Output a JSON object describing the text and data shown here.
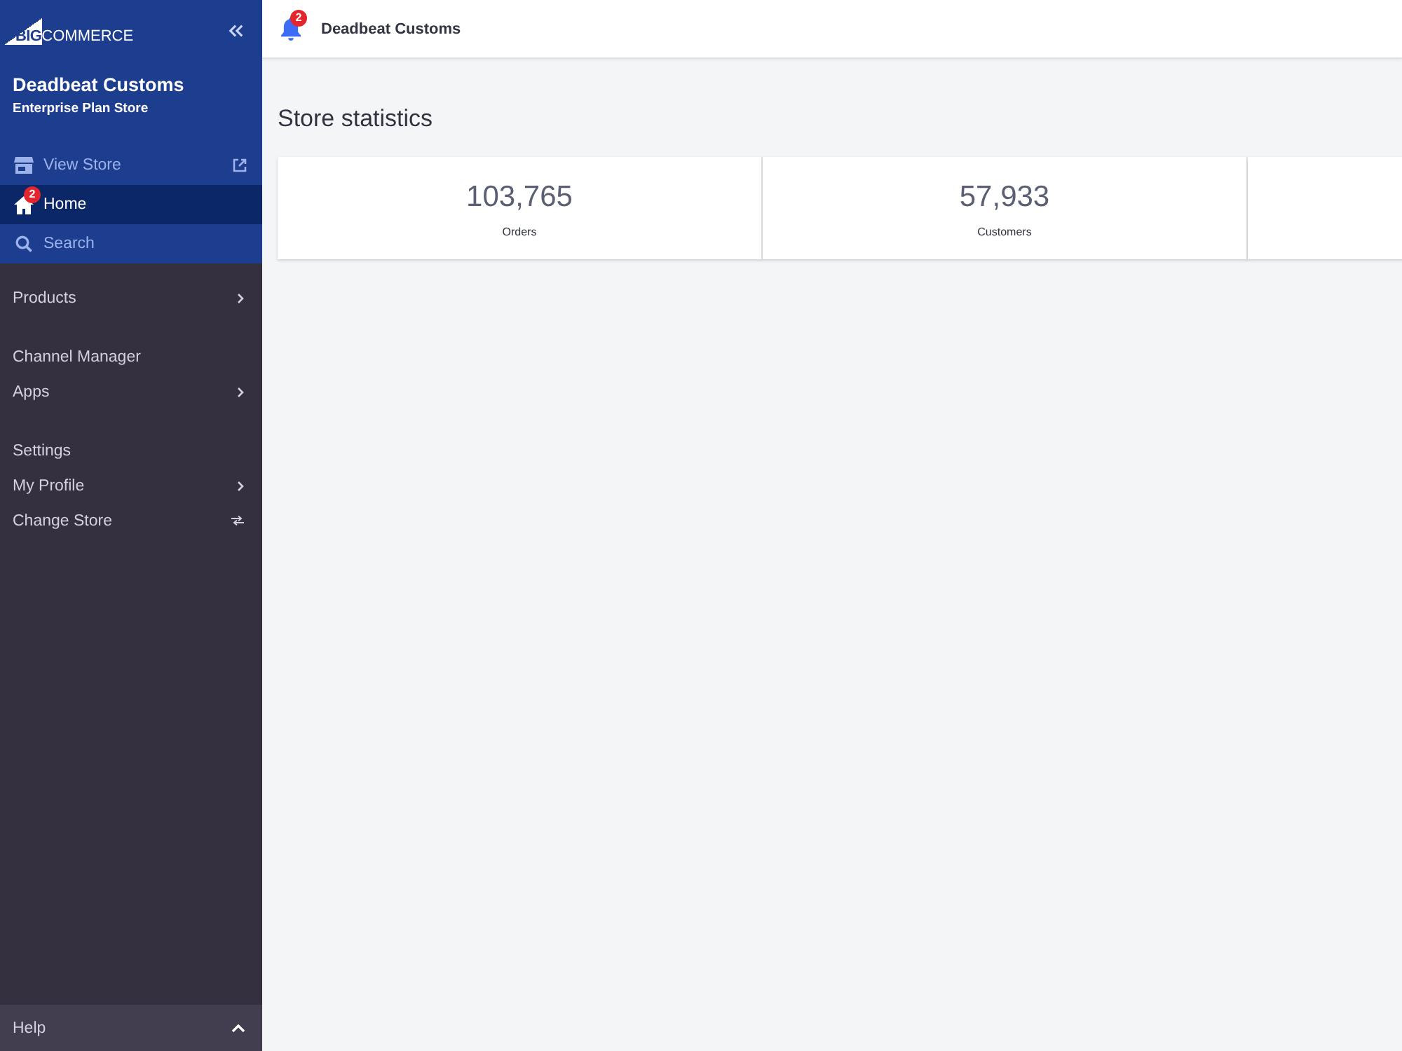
{
  "sidebar": {
    "logo": {
      "mark": "BIG",
      "text": "COMMERCE"
    },
    "store_name": "Deadbeat Customs",
    "plan": "Enterprise Plan Store",
    "top_items": [
      {
        "label": "View Store",
        "kind": "view",
        "selected": false
      },
      {
        "label": "Home",
        "kind": "home",
        "selected": true,
        "badge": "2"
      },
      {
        "label": "Search",
        "kind": "search",
        "selected": false
      }
    ],
    "groups": [
      {
        "items": [
          {
            "label": "Products",
            "kind": "submenu"
          }
        ]
      },
      {
        "items": [
          {
            "label": "Channel Manager",
            "kind": "link"
          },
          {
            "label": "Apps",
            "kind": "submenu"
          }
        ]
      },
      {
        "items": [
          {
            "label": "Settings",
            "kind": "link"
          },
          {
            "label": "My Profile",
            "kind": "submenu"
          },
          {
            "label": "Change Store",
            "kind": "switch"
          }
        ]
      }
    ],
    "footer": {
      "label": "Help"
    }
  },
  "top_bar": {
    "notification_count": "2",
    "store_name": "Deadbeat Customs"
  },
  "store_statistics": {
    "title": "Store statistics",
    "stats": [
      {
        "value": "103,765",
        "label": "Orders"
      },
      {
        "value": "57,933",
        "label": "Customers"
      }
    ]
  }
}
